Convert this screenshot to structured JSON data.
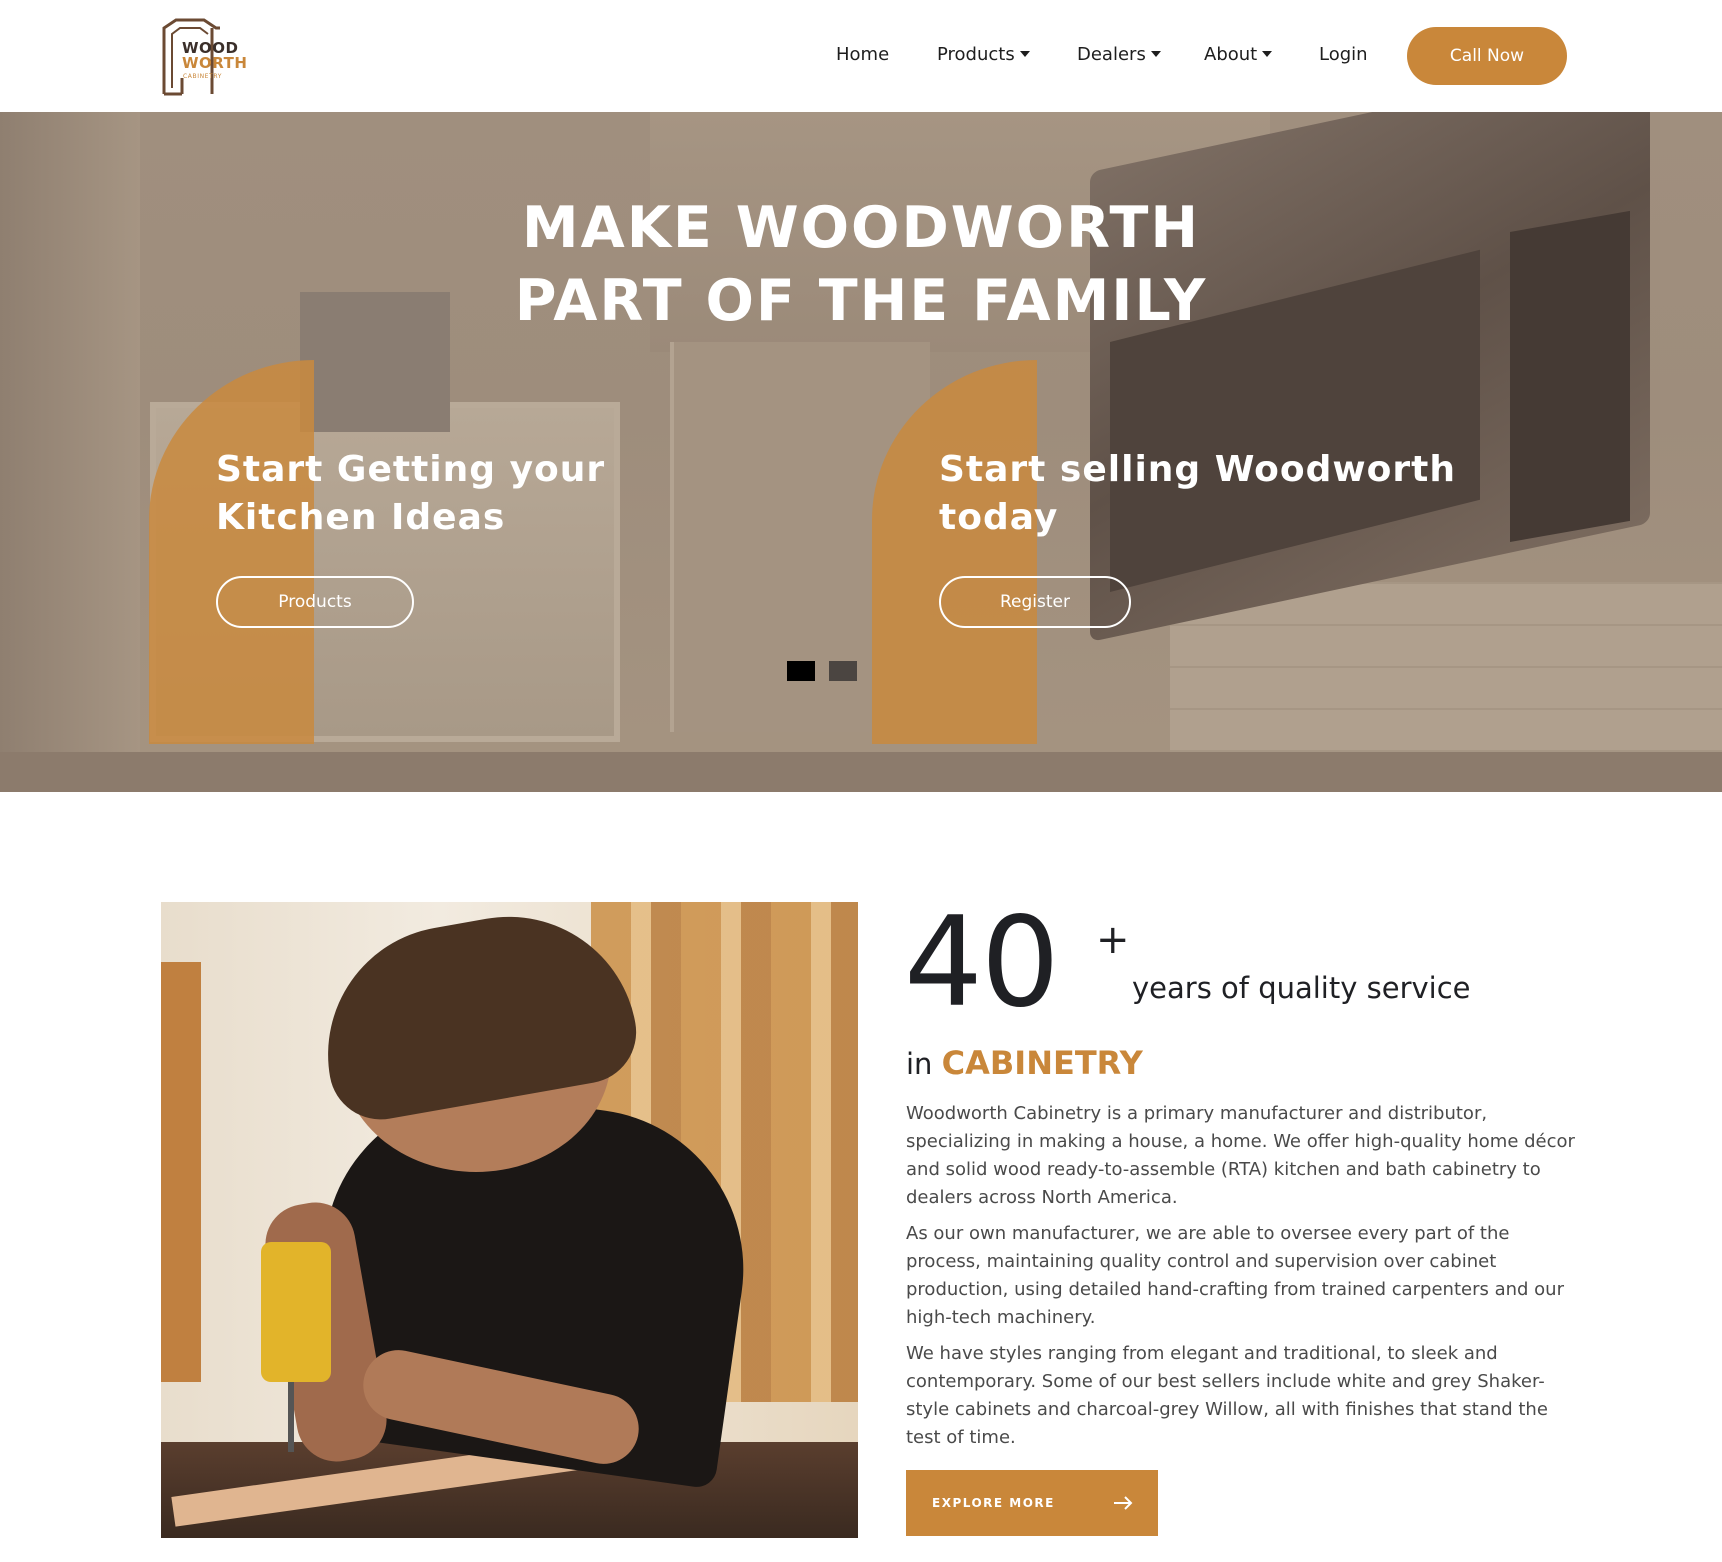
{
  "brand": {
    "logo_line1": "WOOD",
    "logo_line2": "WORTH",
    "logo_line3": "CABINETRY",
    "logo_icon": "house-frame-icon",
    "accent_color": "#c9873a",
    "dark_color": "#3b2f2a"
  },
  "nav": {
    "home": "Home",
    "products": "Products",
    "dealers": "Dealers",
    "about": "About",
    "login": "Login",
    "call_now": "Call Now",
    "dropdown_icon": "caret-down-icon"
  },
  "hero": {
    "title_line1": "MAKE WOODWORTH",
    "title_line2": "PART OF THE FAMILY",
    "cta_left": {
      "title_line1": "Start Getting your",
      "title_line2": "Kitchen Ideas",
      "button": "Products"
    },
    "cta_right": {
      "title_line1": "Start selling Woodworth",
      "title_line2": "today",
      "button": "Register"
    },
    "slider": {
      "slides": 2,
      "active": 1
    }
  },
  "about": {
    "stat_number": "40",
    "stat_plus": "+",
    "stat_label": "years of quality service",
    "in_prefix": "in",
    "in_accent": "CABINETRY",
    "paragraphs": [
      "Woodworth Cabinetry is a primary manufacturer and distributor, specializing in making a house, a home. We offer high-quality home décor and solid wood ready-to-assemble (RTA) kitchen and bath cabinetry to dealers across North America.",
      "As our own manufacturer, we are able to oversee every part of the process, maintaining quality control and supervision over cabinet production, using detailed hand-crafting from trained carpenters and our high-tech machinery.",
      "We have styles ranging from elegant and traditional, to sleek and contemporary. Some of our best sellers include white and grey Shaker-style cabinets and charcoal-grey Willow, all with finishes that stand the test of time."
    ],
    "explore_button": "EXPLORE MORE",
    "explore_icon": "arrow-right-icon"
  }
}
